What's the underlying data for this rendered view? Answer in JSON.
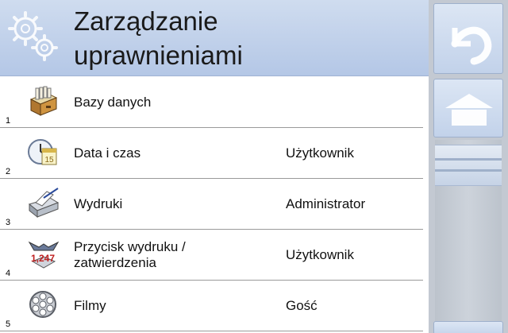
{
  "header": {
    "title_line1": "Zarządzanie",
    "title_line2": "uprawnieniami",
    "icon": "gears-icon"
  },
  "sidebar": {
    "back_icon": "back-arrow-icon",
    "home_icon": "home-icon"
  },
  "scrollbar": {
    "position": 0.0
  },
  "rows": [
    {
      "number": "1",
      "label": "Bazy danych",
      "label2": "",
      "value": "",
      "icon": "database-icon"
    },
    {
      "number": "2",
      "label": "Data i czas",
      "label2": "",
      "value": "Użytkownik",
      "icon": "clock-calendar-icon"
    },
    {
      "number": "3",
      "label": "Wydruki",
      "label2": "",
      "value": "Administrator",
      "icon": "printer-icon"
    },
    {
      "number": "4",
      "label": "Przycisk wydruku /",
      "label2": "zatwierdzenia",
      "value": "Użytkownik",
      "icon": "print-confirm-icon"
    },
    {
      "number": "5",
      "label": "Filmy",
      "label2": "",
      "value": "Gość",
      "icon": "film-reel-icon"
    }
  ]
}
